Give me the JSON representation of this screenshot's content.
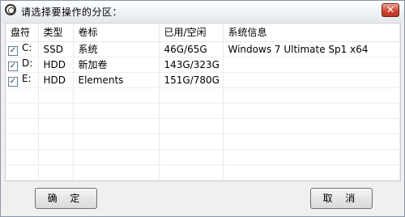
{
  "window": {
    "title": "请选择要操作的分区：",
    "close_glyph": "✕"
  },
  "table": {
    "headers": [
      "盘符",
      "类型",
      "卷标",
      "已用/空闲",
      "系统信息"
    ],
    "rows": [
      {
        "checked": true,
        "drive": "C:",
        "type": "SSD",
        "label": "系统",
        "usage": "46G/65G",
        "sysinfo": "Windows 7 Ultimate Sp1 x64"
      },
      {
        "checked": true,
        "drive": "D:",
        "type": "HDD",
        "label": "新加卷",
        "usage": "143G/323G",
        "sysinfo": ""
      },
      {
        "checked": true,
        "drive": "E:",
        "type": "HDD",
        "label": "Elements",
        "usage": "151G/780G",
        "sysinfo": ""
      }
    ],
    "check_glyph": "✓"
  },
  "buttons": {
    "ok_label": "确 定",
    "cancel_label": "取 消"
  }
}
